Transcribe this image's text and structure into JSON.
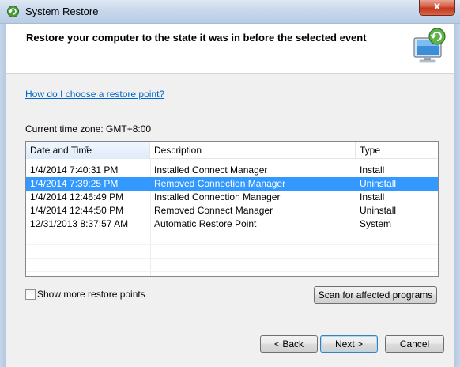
{
  "window": {
    "title": "System Restore",
    "close_glyph": "x"
  },
  "header": {
    "text": "Restore your computer to the state it was in before the selected event",
    "icon": "system-restore-monitor-icon"
  },
  "help_link": "How do I choose a restore point?",
  "timezone": "Current time zone: GMT+8:00",
  "table": {
    "columns": [
      "Date and Time",
      "Description",
      "Type"
    ],
    "sorted_column": "Date and Time",
    "rows": [
      {
        "date": "1/4/2014 7:40:31 PM",
        "desc": "Installed Connect Manager",
        "type": "Install",
        "selected": false
      },
      {
        "date": "1/4/2014 7:39:25 PM",
        "desc": "Removed Connection Manager",
        "type": "Uninstall",
        "selected": true
      },
      {
        "date": "1/4/2014 12:46:49 PM",
        "desc": "Installed Connection Manager",
        "type": "Install",
        "selected": false
      },
      {
        "date": "1/4/2014 12:44:50 PM",
        "desc": "Removed Connect Manager",
        "type": "Uninstall",
        "selected": false
      },
      {
        "date": "12/31/2013 8:37:57 AM",
        "desc": "Automatic Restore Point",
        "type": "System",
        "selected": false
      }
    ],
    "selection_color": "#3399ff"
  },
  "show_more": {
    "label": "Show more restore points",
    "checked": false
  },
  "buttons": {
    "scan": "Scan for affected programs",
    "back": "< Back",
    "next": "Next >",
    "cancel": "Cancel"
  }
}
